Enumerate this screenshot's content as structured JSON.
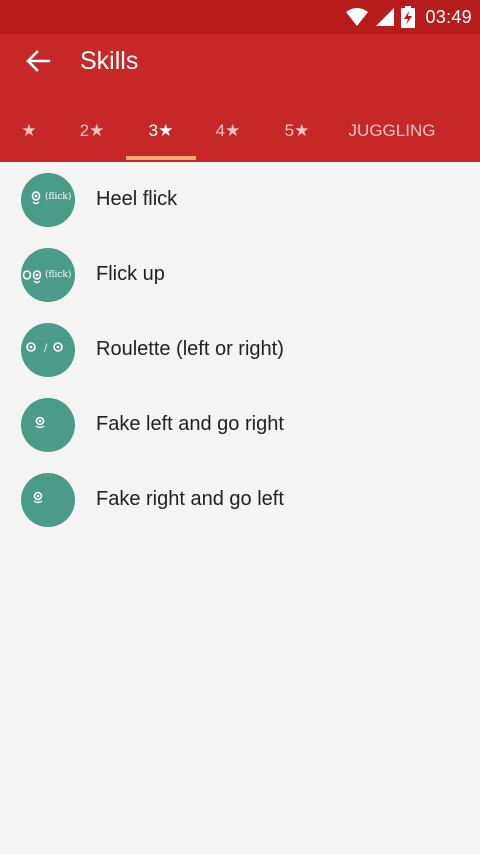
{
  "status_bar": {
    "time": "03:49",
    "icons": [
      "wifi-icon",
      "cell-signal-icon",
      "battery-charging-icon"
    ]
  },
  "app_bar": {
    "back_icon": "arrow-back-icon",
    "title": "Skills",
    "background": "#c62828"
  },
  "tabs": [
    {
      "label": "★",
      "active": false
    },
    {
      "label": "2★",
      "active": false
    },
    {
      "label": "3★",
      "active": true
    },
    {
      "label": "4★",
      "active": false
    },
    {
      "label": "5★",
      "active": false
    },
    {
      "label": "JUGGLING",
      "active": false
    }
  ],
  "skills": [
    {
      "label": "Heel flick",
      "avatar_text": "(flick)"
    },
    {
      "label": "Flick up",
      "avatar_text": "(flick)"
    },
    {
      "label": "Roulette (left or right)",
      "avatar_text": "/"
    },
    {
      "label": "Fake left and go right"
    },
    {
      "label": "Fake right and go left"
    }
  ],
  "colors": {
    "status_bar": "#b71c1c",
    "accent_indicator": "#ffab6b",
    "avatar": "#4a9b88",
    "background": "#f4f4f4"
  }
}
